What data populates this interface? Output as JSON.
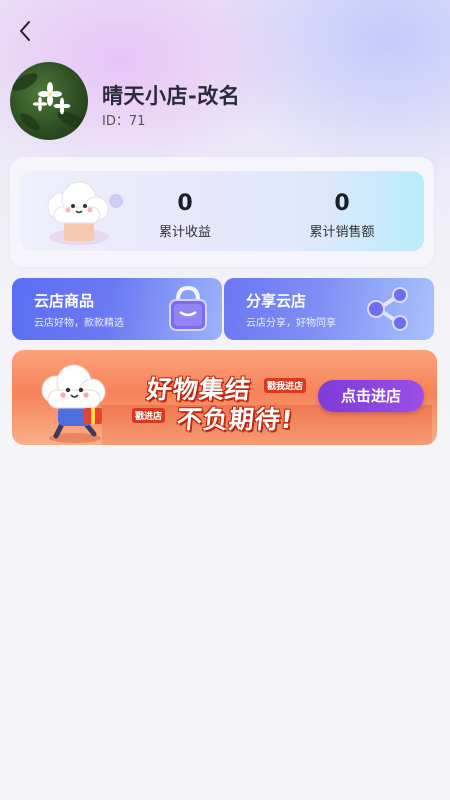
{
  "nav": {
    "back_icon": "chevron-left-icon"
  },
  "profile": {
    "name": "晴天小店-改名",
    "id_text": "ID：71",
    "avatar": "flower-photo-avatar"
  },
  "stats": [
    {
      "value": "0",
      "label": "累计收益"
    },
    {
      "value": "0",
      "label": "累计销售额"
    }
  ],
  "features": {
    "goods": {
      "title": "云店商品",
      "subtitle": "云店好物，款款精选",
      "icon": "shopping-bag-icon"
    },
    "share": {
      "title": "分享云店",
      "subtitle": "云店分享，好物同享",
      "icon": "share-icon"
    }
  },
  "banner": {
    "line1": "好物集结",
    "line2": "不负期待!",
    "tag1": "戳我进店",
    "tag2": "戳进店",
    "button": "点击进店"
  },
  "colors": {
    "accent_blue": "#5b6ef3",
    "banner_orange": "#f7835a",
    "button_purple": "#8a45e0"
  }
}
